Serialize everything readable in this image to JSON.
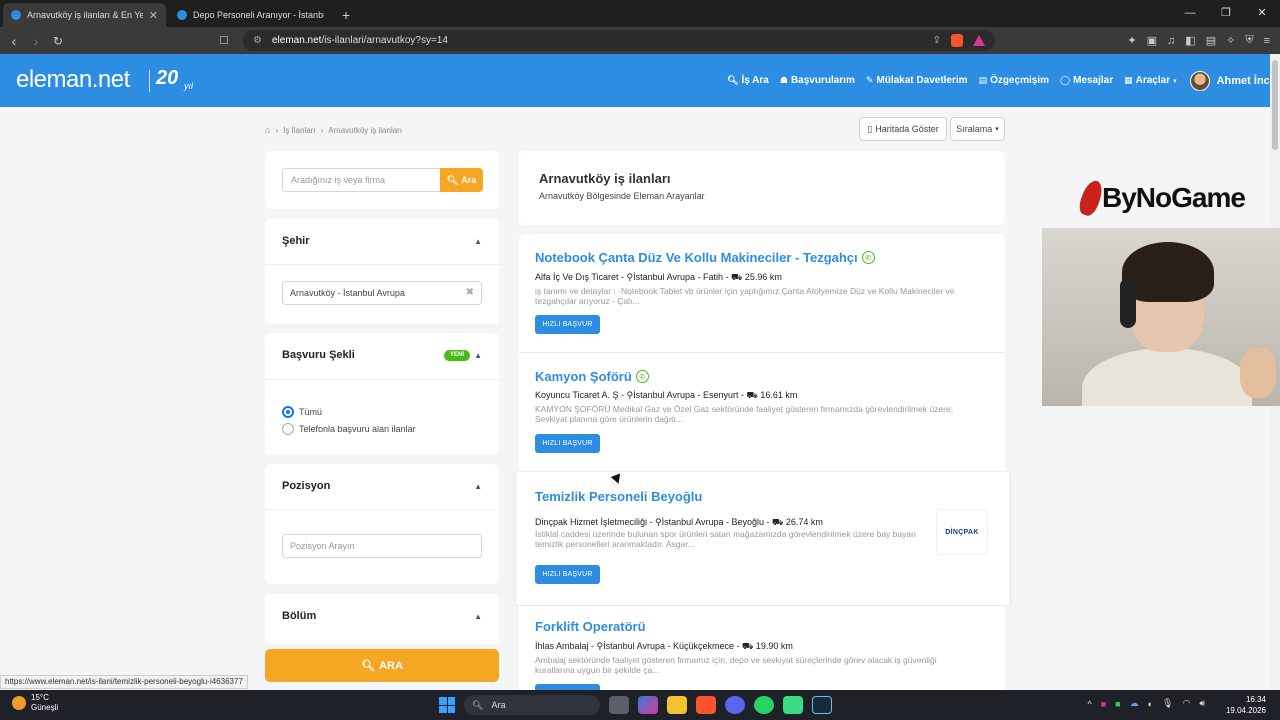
{
  "browser": {
    "tabs": [
      {
        "title": "Arnavutköy iş ilanları & En Yeni A",
        "active": true
      },
      {
        "title": "Depo Personeli Aranıyor - İstanbul A",
        "active": false
      }
    ],
    "new_tab": "+",
    "url_domain": "eleman.net",
    "url_path": "/is-ilanlari/arnavutkoy?sy=14"
  },
  "site": {
    "logo": "eleman.net",
    "logo_anniv": "20",
    "logo_yil": "yıl",
    "nav": [
      {
        "icon": "search-icon",
        "label": "İş Ara"
      },
      {
        "icon": "briefcase-icon",
        "label": "Başvurularım"
      },
      {
        "icon": "edit-icon",
        "label": "Mülakat Davetlerim"
      },
      {
        "icon": "file-icon",
        "label": "Özgeçmişim"
      },
      {
        "icon": "chat-icon",
        "label": "Mesajlar"
      },
      {
        "icon": "tools-icon",
        "label": "Araçlar"
      }
    ],
    "user_name": "Ahmet İnci"
  },
  "breadcrumb": [
    "İş İlanları",
    "Arnavutköy iş ilanları"
  ],
  "top_buttons": {
    "map": "Haritada Göster",
    "sort": "Sıralama"
  },
  "sidebar": {
    "search_placeholder": "Aradığınız iş veya firma",
    "search_button": "Ara",
    "city_title": "Şehir",
    "city_value": "Arnavutköy - İstanbul Avrupa",
    "apply_title": "Başvuru Şekli",
    "new_badge": "YENİ",
    "apply_options": [
      "Tümü",
      "Telefonla başvuru alan ilanlar"
    ],
    "position_title": "Pozisyon",
    "position_placeholder": "Pozisyon Arayın",
    "section_title": "Bölüm",
    "ara_button": "ARA"
  },
  "listing": {
    "title": "Arnavutköy iş ilanları",
    "subtitle": "Arnavutköy Bölgesinde Eleman Arayanlar",
    "apply_label": "HIZLI BAŞVUR",
    "jobs": [
      {
        "title": "Notebook Çanta Düz Ve Kollu Makineciler - Tezgahçı",
        "company": "Alfa İç Ve Dış Ticaret",
        "location": "İstanbul Avrupa - Fatih",
        "distance": "25.96 km",
        "desc": "iş tanımı ve detaylar : -Notebook Tablet vb ürünler için yaptığımız Çanta Atolyemize Düz ve Kollu Makineciler ve tezgahçılar arıyoruz - Çalı..."
      },
      {
        "title": "Kamyon Şoförü",
        "company": "Koyuncu Ticaret A. Ş",
        "location": "İstanbul Avrupa - Esenyurt",
        "distance": "16.61 km",
        "desc": "KAMYON ŞOFÖRÜ Medikal Gaz ve Özel Gaz sektöründe faaliyet gösteren firmamızda görevlendirilmek üzere; Sevkiyat planına göre ürünlerin dağıtı..."
      },
      {
        "title": "Temizlik Personeli Beyoğlu",
        "company": "Dinçpak Hizmet İşletmeciliği",
        "location": "İstanbul Avrupa - Beyoğlu",
        "distance": "26.74 km",
        "desc": "İstiklal caddesi üzerinde bulunan spor ürünleri satan mağazamızda görevlendirilmek üzere bay bayan temizlik personelleri aranmaktadır. Asgar...",
        "logo_text": "DİNÇPAK"
      },
      {
        "title": "Forklift Operatörü",
        "company": "İhlas Ambalaj",
        "location": "İstanbul Avrupa - Küçükçekmece",
        "distance": "19.90 km",
        "desc": "Ambalaj sektöründe faaliyet gösteren firmamız için, depo ve sevkiyat süreçlerinde görev alacak iş güvenliği kurallarına uygun bir şekilde ça..."
      }
    ]
  },
  "overlay": {
    "brand": "ByNoGame"
  },
  "status_url": "https://www.eleman.net/is-ilani/temizlik-personeli-beyoglu-i4636377",
  "taskbar": {
    "temp": "15°C",
    "weather": "Güneşli",
    "search": "Ara",
    "time": "16:34",
    "date": "19.04.2026"
  },
  "colors": {
    "brand_blue": "#2d8de3",
    "accent_orange": "#f5a623",
    "badge_green": "#4cbb17"
  }
}
